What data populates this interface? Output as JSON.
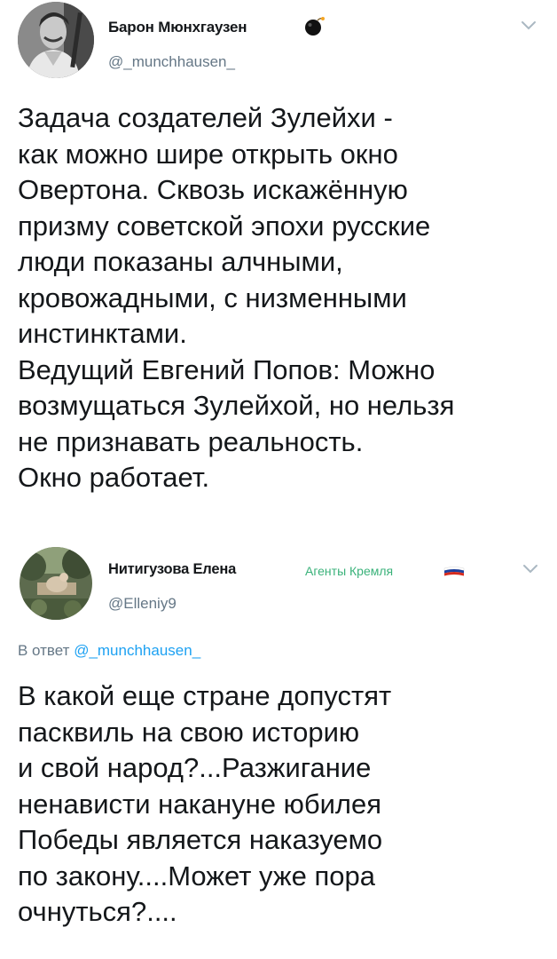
{
  "tweets": [
    {
      "display_name": "Барон Мюнхгаузен",
      "handle": "@_munchhausen_",
      "name_icon": "bomb-icon",
      "menu_icon": "chevron-down-icon",
      "text_lines": [
        "Задача создателей Зулейхи -",
        "как можно шире открыть окно",
        "Овертона. Сквозь искажённую",
        "призму советской эпохи русские",
        "люди показаны алчными,",
        "кровожадными, с низменными",
        "инстинктами.",
        "Ведущий Евгений Попов: Можно",
        "возмущаться Зулейхой, но нельзя",
        "не признавать реальность.",
        "Окно работает."
      ]
    },
    {
      "display_name": "Нитигузова Елена",
      "badge": "Агенты Кремля",
      "badge_icon": "russian-flag-icon",
      "handle": "@Elleniy9",
      "menu_icon": "chevron-down-icon",
      "reply_prefix": "В ответ",
      "reply_to": "@_munchhausen_",
      "text_lines": [
        "В какой еще стране допустят",
        "пасквиль на свою историю",
        "и свой народ?...Разжигание",
        "ненависти накануне юбилея",
        "Победы является наказуемо",
        "по закону....Может уже пора",
        "очнуться?...."
      ]
    }
  ],
  "colors": {
    "text": "#14171a",
    "secondary": "#657786",
    "link": "#1da1f2",
    "badge": "#3ab27a",
    "flag_white": "#ffffff",
    "flag_blue": "#1c3f9e",
    "flag_red": "#d52b1e"
  }
}
